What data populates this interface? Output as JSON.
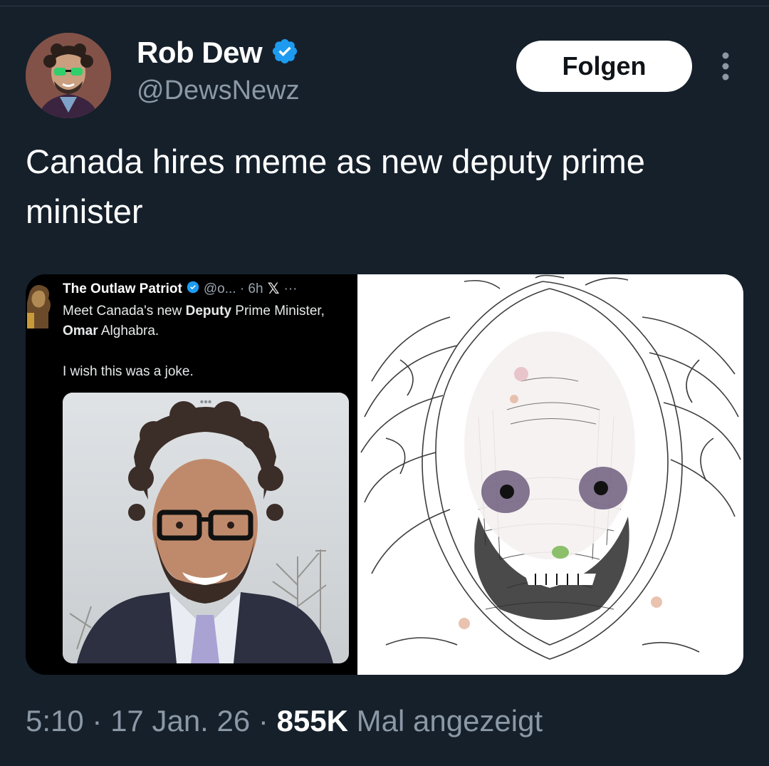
{
  "author": {
    "display_name": "Rob Dew",
    "handle": "@DewsNewz",
    "verified_icon": "verified-badge-icon",
    "follow_label": "Folgen",
    "accent_color": "#1d9bf0"
  },
  "tweet": {
    "text": "Canada hires meme as new deputy prime minister"
  },
  "embedded_screenshot": {
    "author_name": "The Outlaw Patriot",
    "meta": "@o... · 6h",
    "x_label": "𝕏",
    "body_part1": "Meet Canada's new ",
    "body_bold1": "Deputy",
    "body_part2": " Prime Minister, ",
    "body_bold2": "Omar",
    "body_part3": " Alghabra.",
    "joke_line": "I wish this was a joke.",
    "photo_dots": "•••"
  },
  "footer": {
    "time": "5:10",
    "sep1": " · ",
    "date": "17 Jan. 26",
    "sep2": " · ",
    "views_count": "855K",
    "views_label": " Mal angezeigt"
  }
}
